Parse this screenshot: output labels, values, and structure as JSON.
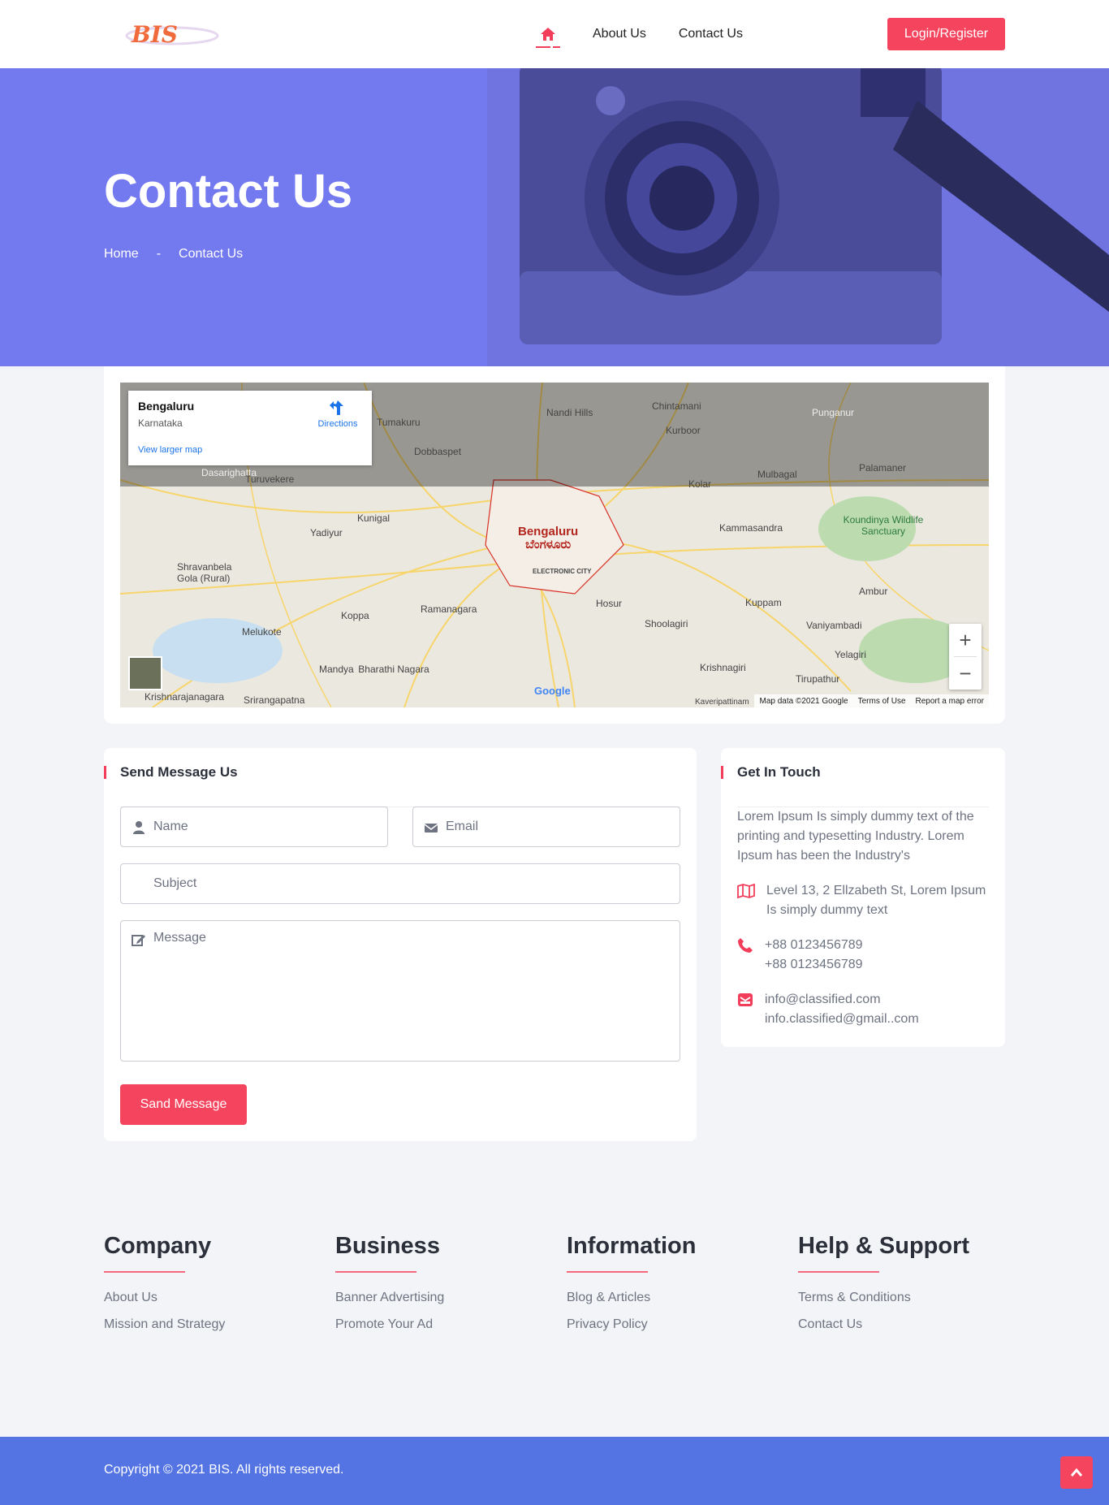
{
  "brand": {
    "logo_text": "BIS"
  },
  "nav": {
    "about": "About Us",
    "contact": "Contact Us",
    "login": "Login/Register"
  },
  "hero": {
    "title": "Contact Us",
    "breadcrumb_home": "Home",
    "breadcrumb_sep": "-",
    "breadcrumb_current": "Contact Us"
  },
  "map": {
    "place": "Bengaluru",
    "region": "Karnataka",
    "directions": "Directions",
    "larger_map": "View larger map",
    "city_label_en": "Bengaluru",
    "city_label_kn": "ಬೆಂಗಳೂರು",
    "google": "Google",
    "map_data": "Map data ©2021 Google",
    "terms": "Terms of Use",
    "report": "Report a map error",
    "labels": [
      "Tumakuru",
      "Dobbaspet",
      "Nandi Hills",
      "Chintamani",
      "Kolar",
      "Mulbagal",
      "Palamaner",
      "Kammasandra",
      "Koundinya Wildlife Sanctuary",
      "Hosur",
      "Ramanagara",
      "Kunigal",
      "Yadiyur",
      "Shravanbela Gola (Rural)",
      "Koppa",
      "Melukote",
      "Mandya",
      "Krishnagiri",
      "Ambur",
      "Vaniyambadi",
      "Kuppam",
      "Tirupathur",
      "Yelagiri",
      "Shoolagiri",
      "Dasarighatta",
      "Turuvekere",
      "Srirangapatna",
      "Krishnarajanagara",
      "Bharathi Nagara",
      "Kurboor",
      "Punganur",
      "ELECTRONIC CITY",
      "Kaveripattinam"
    ]
  },
  "form": {
    "title": "Send Message Us",
    "name_placeholder": "Name",
    "email_placeholder": "Email",
    "subject_placeholder": "Subject",
    "message_placeholder": "Message",
    "submit": "Sand Message"
  },
  "touch": {
    "title": "Get In Touch",
    "description": "Lorem Ipsum Is simply dummy text of the printing and typesetting Industry. Lorem Ipsum has been the Industry's",
    "address": "Level 13, 2 Ellzabeth St, Lorem Ipsum Is simply dummy text",
    "phone1": "+88 0123456789",
    "phone2": "+88 0123456789",
    "email1": "info@classified.com",
    "email2": "info.classified@gmail..com"
  },
  "footer": {
    "company": {
      "title": "Company",
      "links": [
        "About Us",
        "Mission and Strategy"
      ]
    },
    "business": {
      "title": "Business",
      "links": [
        "Banner Advertising",
        "Promote Your Ad"
      ]
    },
    "information": {
      "title": "Information",
      "links": [
        "Blog & Articles",
        "Privacy Policy"
      ]
    },
    "support": {
      "title": "Help & Support",
      "links": [
        "Terms & Conditions",
        "Contact Us"
      ]
    },
    "copyright": "Copyright © 2021 BIS. All rights reserved."
  },
  "colors": {
    "accent": "#f5455e",
    "hero": "#7379ee",
    "footer_bar": "#5474e4"
  }
}
